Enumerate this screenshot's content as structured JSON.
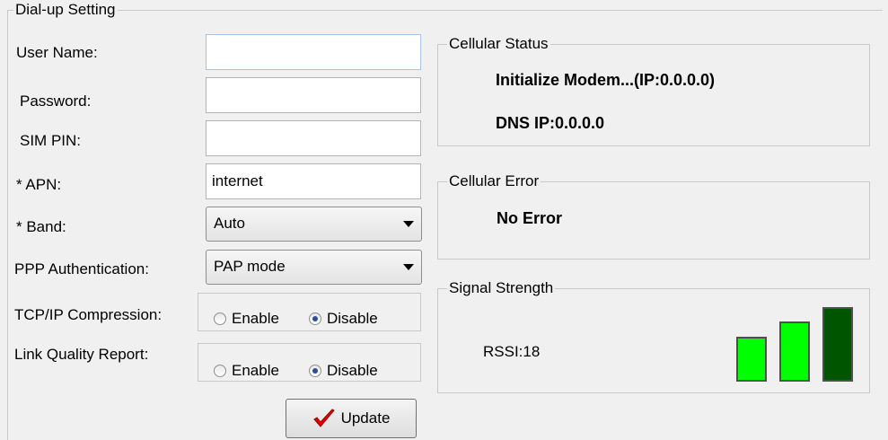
{
  "dialup": {
    "title": "Dial-up Setting",
    "user_name_label": "User Name:",
    "user_name_value": "",
    "password_label": "Password:",
    "password_value": "",
    "sim_pin_label": "SIM PIN:",
    "sim_pin_value": "",
    "apn_label": "* APN:",
    "apn_value": "internet",
    "band_label": "* Band:",
    "band_value": "Auto",
    "ppp_label": "PPP Authentication:",
    "ppp_value": "PAP mode",
    "tcp_label": "TCP/IP Compression:",
    "tcp_enable": "Enable",
    "tcp_disable": "Disable",
    "tcp_selected": "Disable",
    "lqr_label": "Link Quality Report:",
    "lqr_enable": "Enable",
    "lqr_disable": "Disable",
    "lqr_selected": "Disable",
    "update_label": "Update"
  },
  "cellular_status": {
    "title": "Cellular Status",
    "line1": "Initialize Modem...(IP:0.0.0.0)",
    "line2": "DNS IP:0.0.0.0"
  },
  "cellular_error": {
    "title": "Cellular Error",
    "message": "No Error"
  },
  "signal": {
    "title": "Signal Strength",
    "rssi": "RSSI:18",
    "bars_on_color": "#00ff00",
    "bar_top_color": "#005500"
  },
  "colors": {
    "panel_bg": "#f0f0f0",
    "update_check": "#e00000"
  }
}
